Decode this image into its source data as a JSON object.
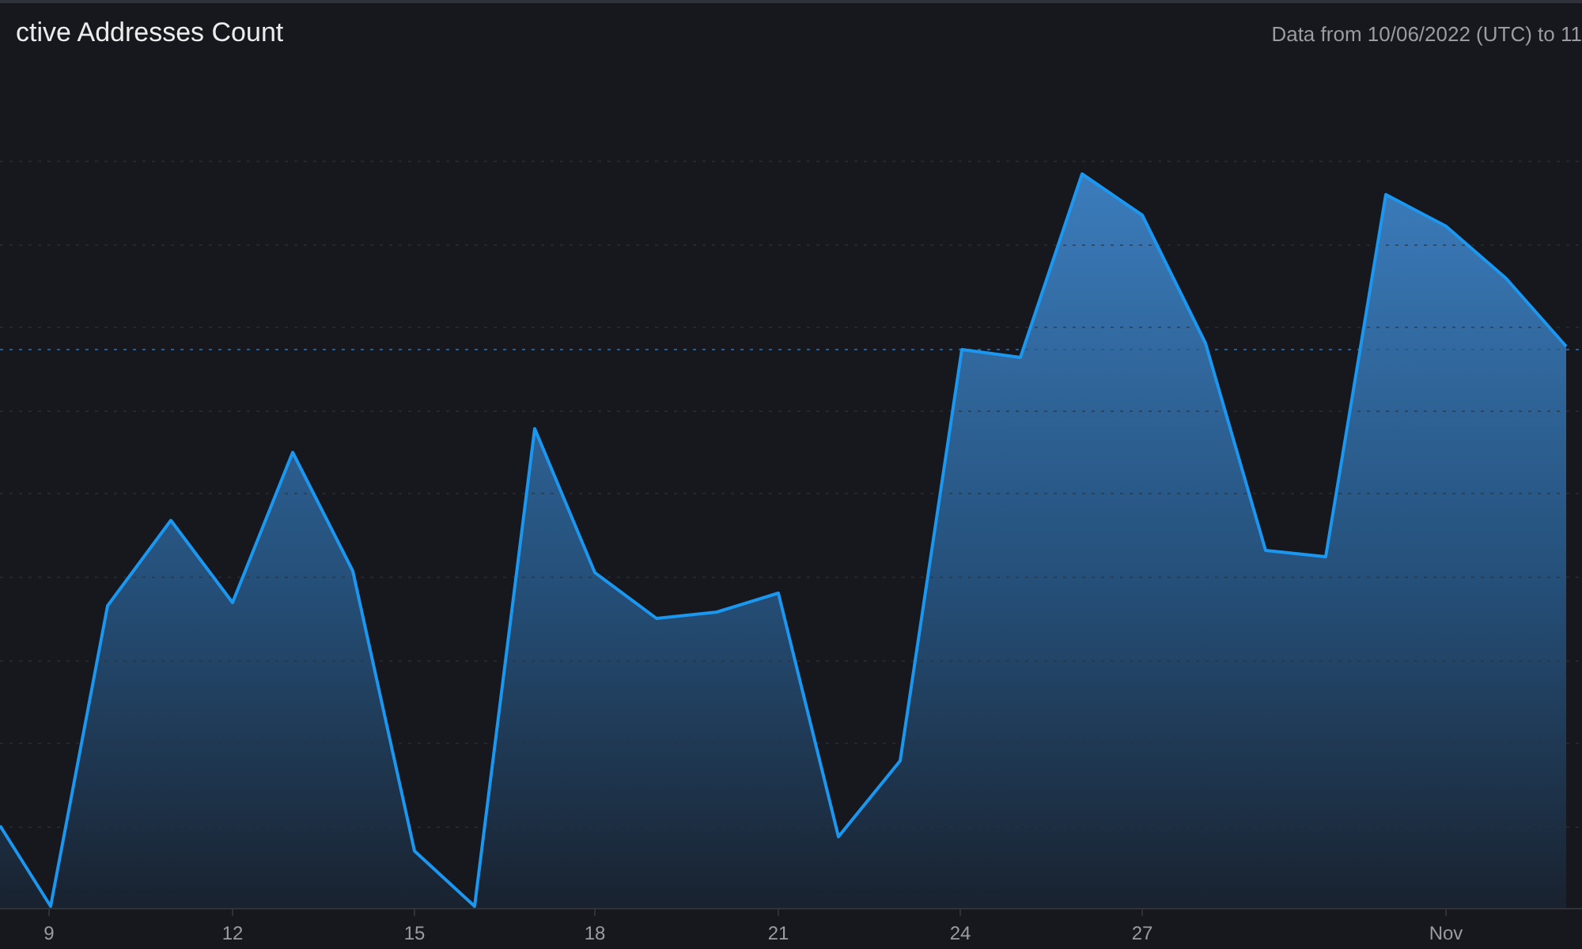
{
  "header": {
    "title": "ctive Addresses Count",
    "date_range": "Data from 10/06/2022 (UTC) to 11"
  },
  "chart": {
    "x_axis_labels": [
      "9",
      "12",
      "15",
      "18",
      "21",
      "24",
      "27",
      "Nov"
    ]
  }
}
